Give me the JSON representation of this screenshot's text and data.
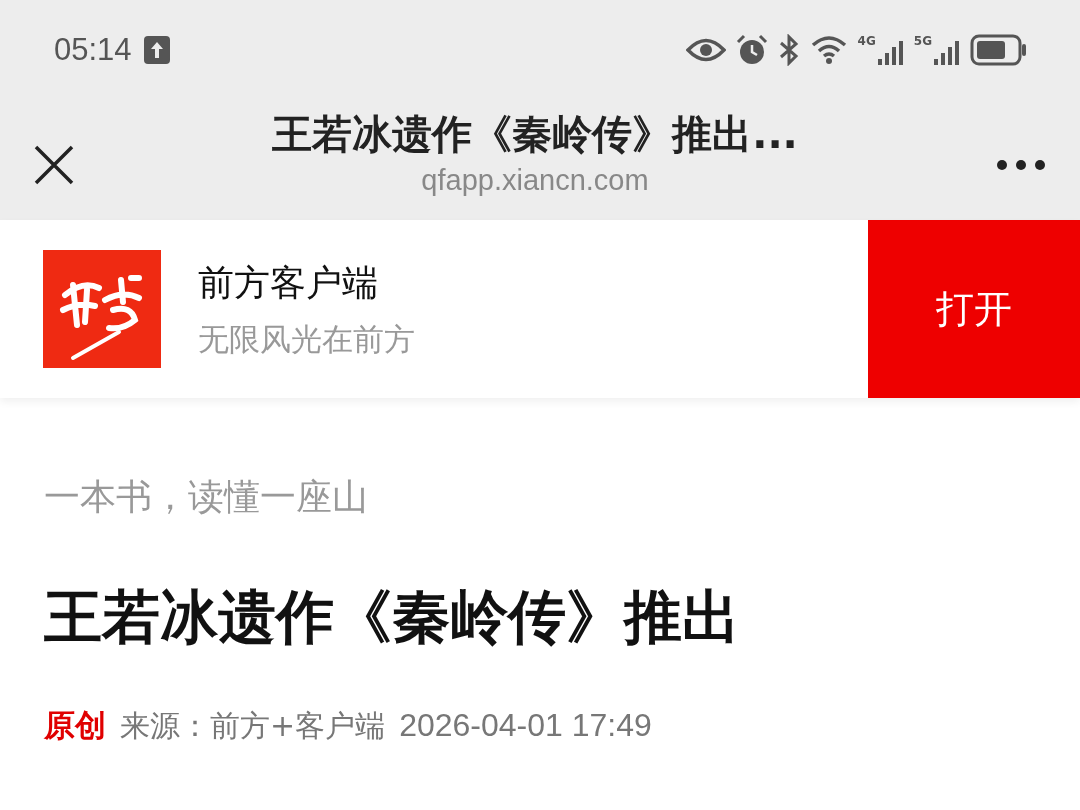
{
  "status_bar": {
    "time": "05:14",
    "network_labels": [
      "4G",
      "5G"
    ]
  },
  "header": {
    "title": "王若冰遗作《秦岭传》推出...",
    "url": "qfapp.xiancn.com"
  },
  "app_banner": {
    "name": "前方客户端",
    "slogan": "无限风光在前方",
    "open_button": "打开"
  },
  "article": {
    "subtitle": "一本书，读懂一座山",
    "title": "王若冰遗作《秦岭传》推出",
    "tag": "原创",
    "source": "来源：前方+客户端",
    "date": "2026-04-01 17:49"
  }
}
